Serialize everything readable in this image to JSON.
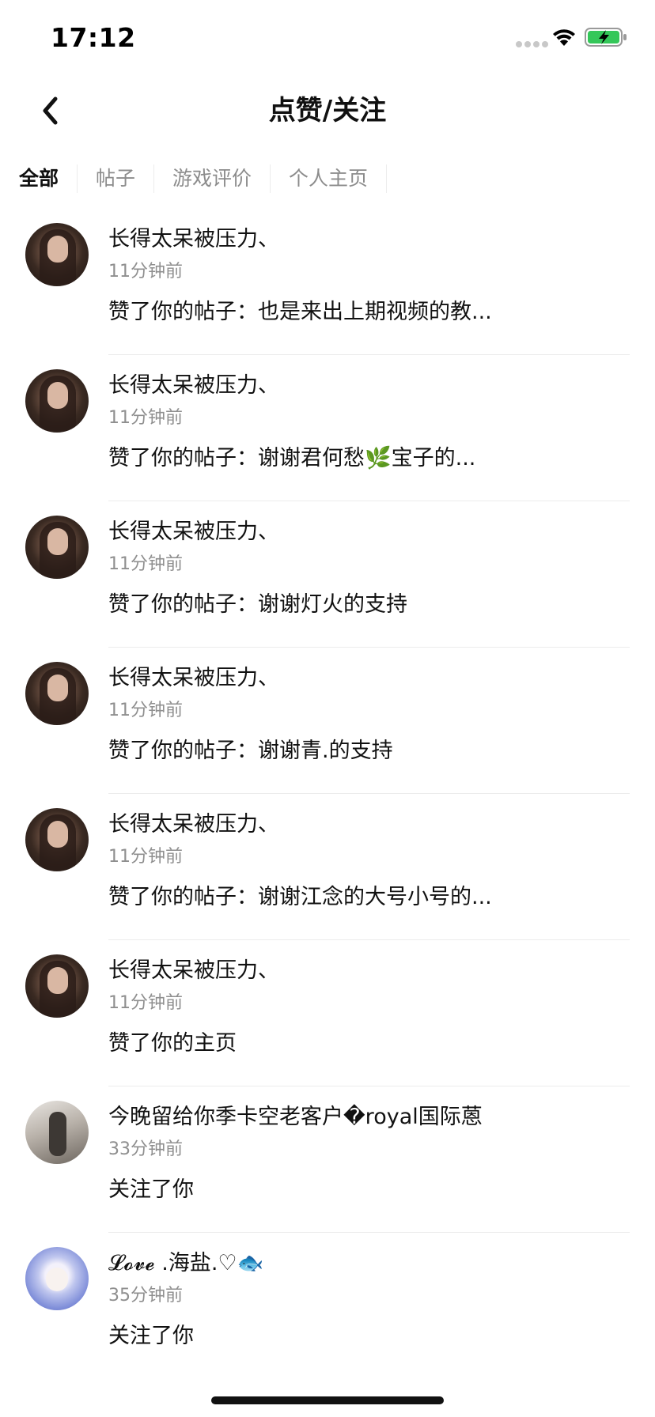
{
  "status_bar": {
    "time": "17:12"
  },
  "header": {
    "title": "点赞/关注"
  },
  "tabs": [
    {
      "label": "全部",
      "active": true
    },
    {
      "label": "帖子",
      "active": false
    },
    {
      "label": "游戏评价",
      "active": false
    },
    {
      "label": "个人主页",
      "active": false
    }
  ],
  "notifications": [
    {
      "name": "长得太呆被压力、",
      "time": "11分钟前",
      "message": "赞了你的帖子：也是来出上期视频的教..."
    },
    {
      "name": "长得太呆被压力、",
      "time": "11分钟前",
      "message": "赞了你的帖子：谢谢君何愁🌿宝子的..."
    },
    {
      "name": "长得太呆被压力、",
      "time": "11分钟前",
      "message": "赞了你的帖子：谢谢灯火的支持"
    },
    {
      "name": "长得太呆被压力、",
      "time": "11分钟前",
      "message": "赞了你的帖子：谢谢青.的支持"
    },
    {
      "name": "长得太呆被压力、",
      "time": "11分钟前",
      "message": "赞了你的帖子：谢谢江念的大号小号的..."
    },
    {
      "name": "长得太呆被压力、",
      "time": "11分钟前",
      "message": "赞了你的主页"
    },
    {
      "name": "今晚留给你季卡空老客户�royal国际蒽",
      "time": "33分钟前",
      "message": "关注了你"
    },
    {
      "name": "𝓛𝓸𝓿𝓮 .海盐.♡🐟",
      "time": "35分钟前",
      "message": "关注了你"
    }
  ],
  "icons": {
    "back": "chevron-left-icon",
    "wifi": "wifi-icon",
    "battery": "battery-charging-icon"
  },
  "colors": {
    "battery_fill": "#34c759",
    "secondary_text": "#8f8f8f"
  }
}
